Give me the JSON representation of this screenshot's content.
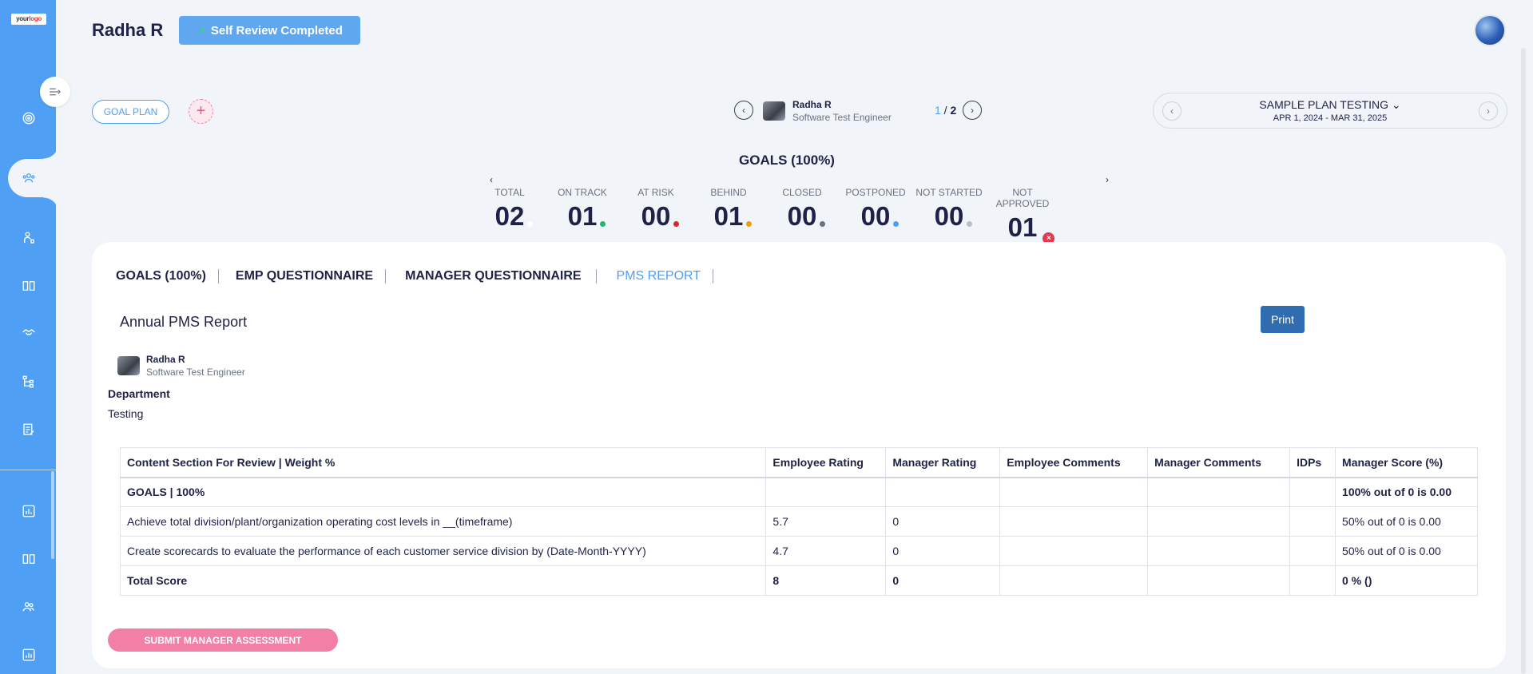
{
  "sidebar": {
    "logo_text_a": "your",
    "logo_text_b": "logo",
    "icons": [
      "target-icon",
      "team-icon",
      "user-tree-icon",
      "book-icon",
      "handshake-icon",
      "hierarchy-icon",
      "document-edit-icon",
      "bar-chart-icon",
      "book-icon",
      "people-icon",
      "analytics-icon"
    ]
  },
  "header": {
    "user_name": "Radha R",
    "status_label": "Self Review Completed"
  },
  "toolbar": {
    "goal_plan_label": "GOAL PLAN",
    "add_label": "+"
  },
  "pager": {
    "employee_name": "Radha R",
    "employee_title": "Software Test Engineer",
    "current": "1",
    "separator": " / ",
    "total": "2"
  },
  "plan": {
    "name": "SAMPLE PLAN TESTING",
    "dates": "APR 1, 2024 - MAR 31, 2025"
  },
  "goals_summary": {
    "heading": "GOALS (100%)",
    "stats": [
      {
        "label": "TOTAL",
        "value": "02",
        "color": "#ffffff"
      },
      {
        "label": "ON TRACK",
        "value": "01",
        "color": "#22b573"
      },
      {
        "label": "AT RISK",
        "value": "00",
        "color": "#e02424"
      },
      {
        "label": "BEHIND",
        "value": "01",
        "color": "#f59e0b"
      },
      {
        "label": "CLOSED",
        "value": "00",
        "color": "#6b7280"
      },
      {
        "label": "POSTPONED",
        "value": "00",
        "color": "#4fa0f5"
      },
      {
        "label": "NOT STARTED",
        "value": "00",
        "color": "#b8bec8"
      },
      {
        "label": "NOT APPROVED",
        "value": "01",
        "color": "#e53950"
      }
    ]
  },
  "tabs": [
    {
      "label": "GOALS (100%)"
    },
    {
      "label": "EMP QUESTIONNAIRE"
    },
    {
      "label": "MANAGER QUESTIONNAIRE"
    },
    {
      "label": "PMS REPORT"
    }
  ],
  "report": {
    "title": "Annual PMS Report",
    "print_label": "Print",
    "employee_name": "Radha R",
    "employee_title": "Software Test Engineer",
    "department_label": "Department",
    "department_value": "Testing",
    "columns": [
      "Content Section For Review | Weight %",
      "Employee Rating",
      "Manager Rating",
      "Employee Comments",
      "Manager Comments",
      "IDPs",
      "Manager Score (%)"
    ],
    "rows": [
      {
        "c0": "GOALS | 100%",
        "c1": "",
        "c2": "",
        "c3": "",
        "c4": "",
        "c5": "",
        "c6": "100% out of 0 is 0.00"
      },
      {
        "c0": "Achieve total division/plant/organization operating cost levels in __(timeframe)",
        "c1": "5.7",
        "c2": "0",
        "c3": "",
        "c4": "",
        "c5": "",
        "c6": "50% out of 0 is 0.00"
      },
      {
        "c0": "Create scorecards to evaluate the performance of each customer service division by (Date-Month-YYYY)",
        "c1": "4.7",
        "c2": "0",
        "c3": "",
        "c4": "",
        "c5": "",
        "c6": "50% out of 0 is 0.00"
      },
      {
        "c0": "Total Score",
        "c1": "8",
        "c2": "0",
        "c3": "",
        "c4": "",
        "c5": "",
        "c6": "0  % ()"
      }
    ],
    "submit_label": "SUBMIT MANAGER ASSESSMENT"
  }
}
